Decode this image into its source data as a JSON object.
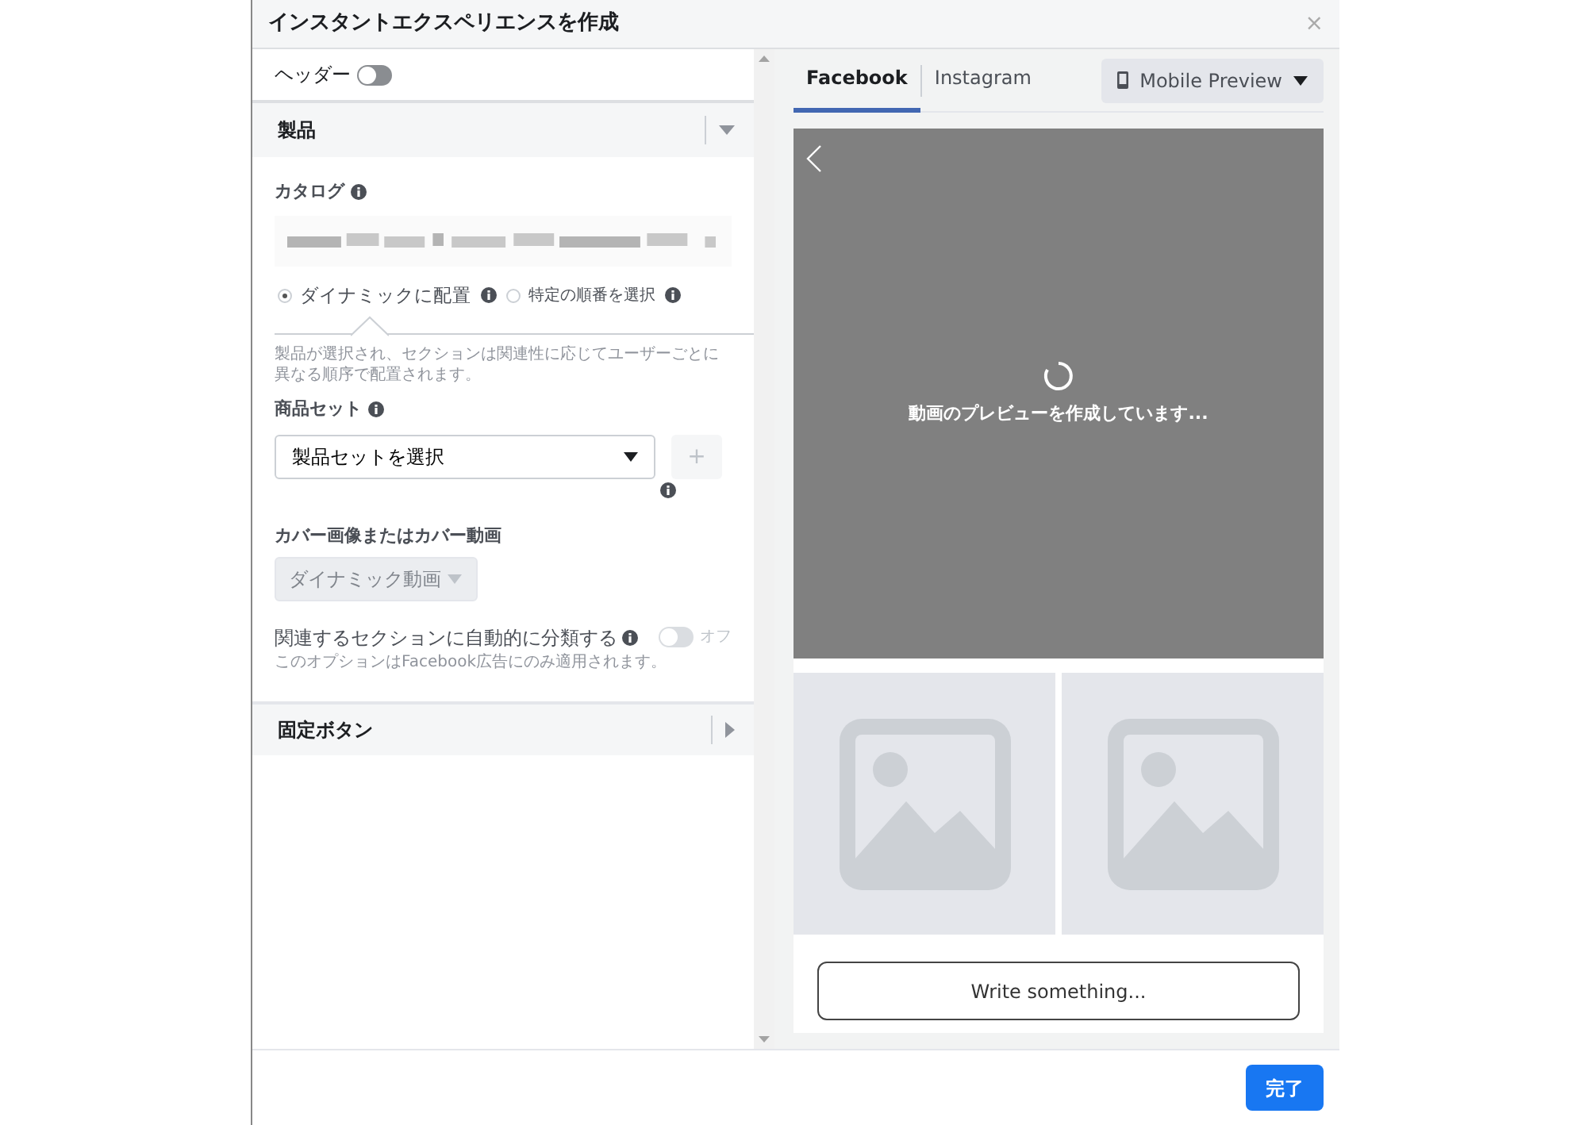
{
  "dialog": {
    "title": "インスタントエクスペリエンスを作成",
    "close": "×"
  },
  "header_toggle": {
    "label": "ヘッダー",
    "on": false
  },
  "product_section": {
    "title": "製品",
    "expanded": true,
    "catalog_label": "カタログ",
    "placement_options": [
      {
        "label": "ダイナミックに配置",
        "selected": true
      },
      {
        "label": "特定の順番を選択",
        "selected": false
      }
    ],
    "placement_help": "製品が選択され、セクションは関連性に応じてユーザーごとに異なる順序で配置されます。",
    "product_set": {
      "label": "商品セット",
      "value": "製品セットを選択",
      "add": "+"
    },
    "cover": {
      "label": "カバー画像またはカバー動画",
      "value": "ダイナミック動画",
      "disabled": true
    },
    "auto_sort": {
      "label": "関連するセクションに自動的に分類する",
      "on": false,
      "state_text": "オフ",
      "note": "このオプションはFacebook広告にのみ適用されます。"
    }
  },
  "fixed_button_section": {
    "title": "固定ボタン",
    "expanded": false
  },
  "preview": {
    "tabs": [
      {
        "label": "Facebook",
        "selected": true
      },
      {
        "label": "Instagram",
        "selected": false
      }
    ],
    "device_button": "Mobile Preview",
    "loading_text": "動画のプレビューを作成しています...",
    "tiles": [
      {
        "kind": "placeholder"
      },
      {
        "kind": "placeholder"
      }
    ],
    "write_button": "Write something..."
  },
  "footer": {
    "done_button": "完了"
  }
}
